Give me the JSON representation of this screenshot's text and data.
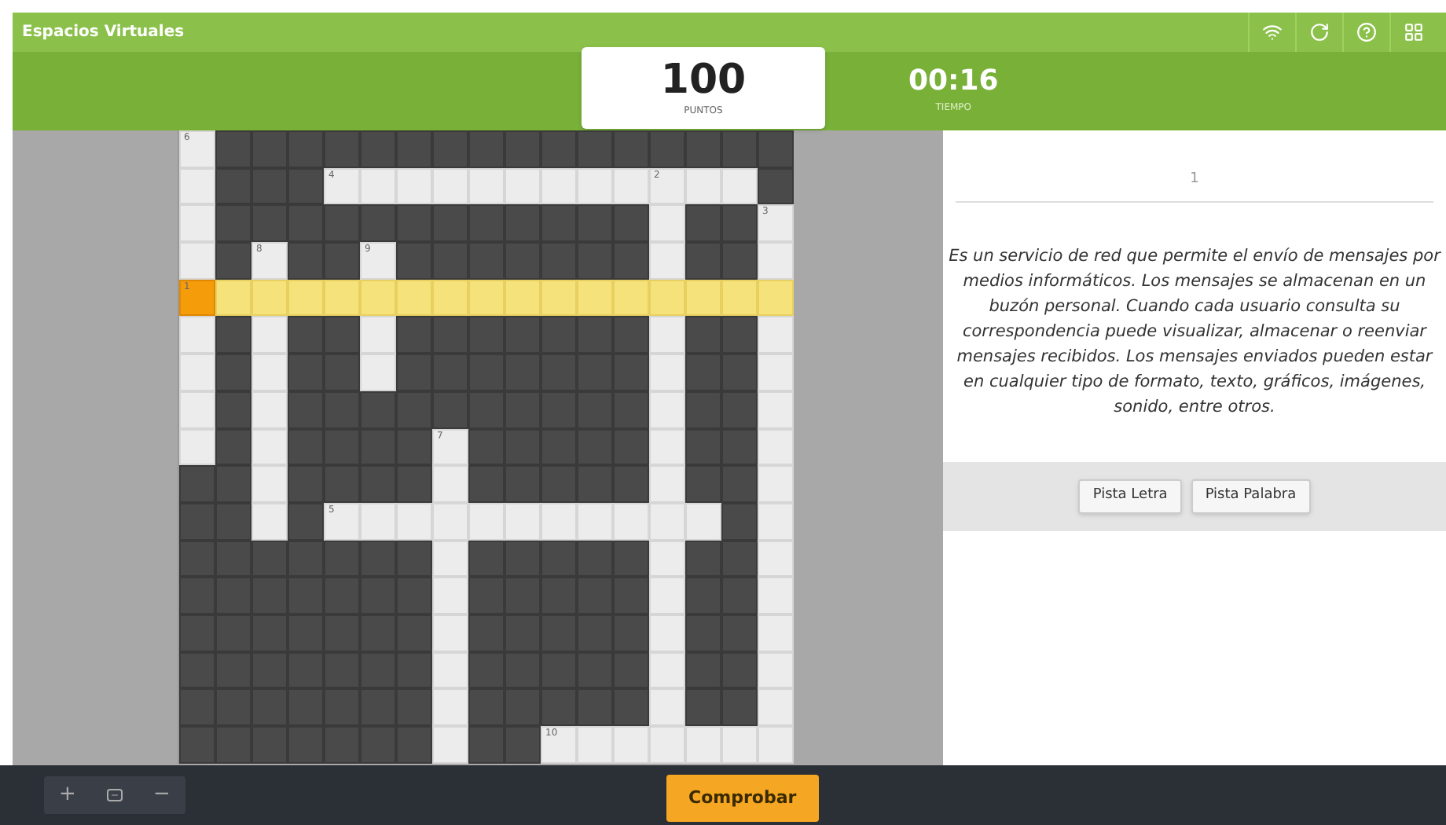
{
  "app": {
    "title": "Espacios Virtuales"
  },
  "score": {
    "value": "100",
    "label": "PUNTOS"
  },
  "timer": {
    "value": "00:16",
    "label": "TIEMPO"
  },
  "grid": {
    "rows": [
      [
        {
          "kind": "open",
          "number": "6"
        },
        {
          "kind": "block"
        },
        {
          "kind": "block"
        },
        {
          "kind": "block"
        },
        {
          "kind": "block"
        },
        {
          "kind": "block"
        },
        {
          "kind": "block"
        },
        {
          "kind": "block"
        },
        {
          "kind": "block"
        },
        {
          "kind": "block"
        },
        {
          "kind": "block"
        },
        {
          "kind": "block"
        },
        {
          "kind": "block"
        },
        {
          "kind": "block"
        },
        {
          "kind": "block"
        },
        {
          "kind": "block"
        },
        {
          "kind": "block"
        }
      ],
      [
        {
          "kind": "open"
        },
        {
          "kind": "block"
        },
        {
          "kind": "block"
        },
        {
          "kind": "block"
        },
        {
          "kind": "open",
          "number": "4"
        },
        {
          "kind": "open"
        },
        {
          "kind": "open"
        },
        {
          "kind": "open"
        },
        {
          "kind": "open"
        },
        {
          "kind": "open"
        },
        {
          "kind": "open"
        },
        {
          "kind": "open"
        },
        {
          "kind": "open"
        },
        {
          "kind": "open",
          "number": "2"
        },
        {
          "kind": "open"
        },
        {
          "kind": "open"
        },
        {
          "kind": "block"
        }
      ],
      [
        {
          "kind": "open"
        },
        {
          "kind": "block"
        },
        {
          "kind": "block"
        },
        {
          "kind": "block"
        },
        {
          "kind": "block"
        },
        {
          "kind": "block"
        },
        {
          "kind": "block"
        },
        {
          "kind": "block"
        },
        {
          "kind": "block"
        },
        {
          "kind": "block"
        },
        {
          "kind": "block"
        },
        {
          "kind": "block"
        },
        {
          "kind": "block"
        },
        {
          "kind": "open"
        },
        {
          "kind": "block"
        },
        {
          "kind": "block"
        },
        {
          "kind": "open",
          "number": "3"
        }
      ],
      [
        {
          "kind": "open"
        },
        {
          "kind": "block"
        },
        {
          "kind": "open",
          "number": "8"
        },
        {
          "kind": "block"
        },
        {
          "kind": "block"
        },
        {
          "kind": "open",
          "number": "9"
        },
        {
          "kind": "block"
        },
        {
          "kind": "block"
        },
        {
          "kind": "block"
        },
        {
          "kind": "block"
        },
        {
          "kind": "block"
        },
        {
          "kind": "block"
        },
        {
          "kind": "block"
        },
        {
          "kind": "open"
        },
        {
          "kind": "block"
        },
        {
          "kind": "block"
        },
        {
          "kind": "open"
        }
      ],
      [
        {
          "kind": "selected",
          "number": "1"
        },
        {
          "kind": "highlighted"
        },
        {
          "kind": "highlighted"
        },
        {
          "kind": "highlighted"
        },
        {
          "kind": "highlighted"
        },
        {
          "kind": "highlighted"
        },
        {
          "kind": "highlighted"
        },
        {
          "kind": "highlighted"
        },
        {
          "kind": "highlighted"
        },
        {
          "kind": "highlighted"
        },
        {
          "kind": "highlighted"
        },
        {
          "kind": "highlighted"
        },
        {
          "kind": "highlighted"
        },
        {
          "kind": "highlighted"
        },
        {
          "kind": "highlighted"
        },
        {
          "kind": "highlighted"
        },
        {
          "kind": "highlighted"
        }
      ],
      [
        {
          "kind": "open"
        },
        {
          "kind": "block"
        },
        {
          "kind": "open"
        },
        {
          "kind": "block"
        },
        {
          "kind": "block"
        },
        {
          "kind": "open"
        },
        {
          "kind": "block"
        },
        {
          "kind": "block"
        },
        {
          "kind": "block"
        },
        {
          "kind": "block"
        },
        {
          "kind": "block"
        },
        {
          "kind": "block"
        },
        {
          "kind": "block"
        },
        {
          "kind": "open"
        },
        {
          "kind": "block"
        },
        {
          "kind": "block"
        },
        {
          "kind": "open"
        }
      ],
      [
        {
          "kind": "open"
        },
        {
          "kind": "block"
        },
        {
          "kind": "open"
        },
        {
          "kind": "block"
        },
        {
          "kind": "block"
        },
        {
          "kind": "open"
        },
        {
          "kind": "block"
        },
        {
          "kind": "block"
        },
        {
          "kind": "block"
        },
        {
          "kind": "block"
        },
        {
          "kind": "block"
        },
        {
          "kind": "block"
        },
        {
          "kind": "block"
        },
        {
          "kind": "open"
        },
        {
          "kind": "block"
        },
        {
          "kind": "block"
        },
        {
          "kind": "open"
        }
      ],
      [
        {
          "kind": "open"
        },
        {
          "kind": "block"
        },
        {
          "kind": "open"
        },
        {
          "kind": "block"
        },
        {
          "kind": "block"
        },
        {
          "kind": "block"
        },
        {
          "kind": "block"
        },
        {
          "kind": "block"
        },
        {
          "kind": "block"
        },
        {
          "kind": "block"
        },
        {
          "kind": "block"
        },
        {
          "kind": "block"
        },
        {
          "kind": "block"
        },
        {
          "kind": "open"
        },
        {
          "kind": "block"
        },
        {
          "kind": "block"
        },
        {
          "kind": "open"
        }
      ],
      [
        {
          "kind": "open"
        },
        {
          "kind": "block"
        },
        {
          "kind": "open"
        },
        {
          "kind": "block"
        },
        {
          "kind": "block"
        },
        {
          "kind": "block"
        },
        {
          "kind": "block"
        },
        {
          "kind": "open",
          "number": "7"
        },
        {
          "kind": "block"
        },
        {
          "kind": "block"
        },
        {
          "kind": "block"
        },
        {
          "kind": "block"
        },
        {
          "kind": "block"
        },
        {
          "kind": "open"
        },
        {
          "kind": "block"
        },
        {
          "kind": "block"
        },
        {
          "kind": "open"
        }
      ],
      [
        {
          "kind": "block"
        },
        {
          "kind": "block"
        },
        {
          "kind": "open"
        },
        {
          "kind": "block"
        },
        {
          "kind": "block"
        },
        {
          "kind": "block"
        },
        {
          "kind": "block"
        },
        {
          "kind": "open"
        },
        {
          "kind": "block"
        },
        {
          "kind": "block"
        },
        {
          "kind": "block"
        },
        {
          "kind": "block"
        },
        {
          "kind": "block"
        },
        {
          "kind": "open"
        },
        {
          "kind": "block"
        },
        {
          "kind": "block"
        },
        {
          "kind": "open"
        }
      ],
      [
        {
          "kind": "block"
        },
        {
          "kind": "block"
        },
        {
          "kind": "open"
        },
        {
          "kind": "block"
        },
        {
          "kind": "open",
          "number": "5"
        },
        {
          "kind": "open"
        },
        {
          "kind": "open"
        },
        {
          "kind": "open"
        },
        {
          "kind": "open"
        },
        {
          "kind": "open"
        },
        {
          "kind": "open"
        },
        {
          "kind": "open"
        },
        {
          "kind": "open"
        },
        {
          "kind": "open"
        },
        {
          "kind": "open"
        },
        {
          "kind": "block"
        },
        {
          "kind": "open"
        }
      ],
      [
        {
          "kind": "block"
        },
        {
          "kind": "block"
        },
        {
          "kind": "block"
        },
        {
          "kind": "block"
        },
        {
          "kind": "block"
        },
        {
          "kind": "block"
        },
        {
          "kind": "block"
        },
        {
          "kind": "open"
        },
        {
          "kind": "block"
        },
        {
          "kind": "block"
        },
        {
          "kind": "block"
        },
        {
          "kind": "block"
        },
        {
          "kind": "block"
        },
        {
          "kind": "open"
        },
        {
          "kind": "block"
        },
        {
          "kind": "block"
        },
        {
          "kind": "open"
        }
      ],
      [
        {
          "kind": "block"
        },
        {
          "kind": "block"
        },
        {
          "kind": "block"
        },
        {
          "kind": "block"
        },
        {
          "kind": "block"
        },
        {
          "kind": "block"
        },
        {
          "kind": "block"
        },
        {
          "kind": "open"
        },
        {
          "kind": "block"
        },
        {
          "kind": "block"
        },
        {
          "kind": "block"
        },
        {
          "kind": "block"
        },
        {
          "kind": "block"
        },
        {
          "kind": "open"
        },
        {
          "kind": "block"
        },
        {
          "kind": "block"
        },
        {
          "kind": "open"
        }
      ],
      [
        {
          "kind": "block"
        },
        {
          "kind": "block"
        },
        {
          "kind": "block"
        },
        {
          "kind": "block"
        },
        {
          "kind": "block"
        },
        {
          "kind": "block"
        },
        {
          "kind": "block"
        },
        {
          "kind": "open"
        },
        {
          "kind": "block"
        },
        {
          "kind": "block"
        },
        {
          "kind": "block"
        },
        {
          "kind": "block"
        },
        {
          "kind": "block"
        },
        {
          "kind": "open"
        },
        {
          "kind": "block"
        },
        {
          "kind": "block"
        },
        {
          "kind": "open"
        }
      ],
      [
        {
          "kind": "block"
        },
        {
          "kind": "block"
        },
        {
          "kind": "block"
        },
        {
          "kind": "block"
        },
        {
          "kind": "block"
        },
        {
          "kind": "block"
        },
        {
          "kind": "block"
        },
        {
          "kind": "open"
        },
        {
          "kind": "block"
        },
        {
          "kind": "block"
        },
        {
          "kind": "block"
        },
        {
          "kind": "block"
        },
        {
          "kind": "block"
        },
        {
          "kind": "open"
        },
        {
          "kind": "block"
        },
        {
          "kind": "block"
        },
        {
          "kind": "open"
        }
      ],
      [
        {
          "kind": "block"
        },
        {
          "kind": "block"
        },
        {
          "kind": "block"
        },
        {
          "kind": "block"
        },
        {
          "kind": "block"
        },
        {
          "kind": "block"
        },
        {
          "kind": "block"
        },
        {
          "kind": "open"
        },
        {
          "kind": "block"
        },
        {
          "kind": "block"
        },
        {
          "kind": "block"
        },
        {
          "kind": "block"
        },
        {
          "kind": "block"
        },
        {
          "kind": "open"
        },
        {
          "kind": "block"
        },
        {
          "kind": "block"
        },
        {
          "kind": "open"
        }
      ],
      [
        {
          "kind": "block"
        },
        {
          "kind": "block"
        },
        {
          "kind": "block"
        },
        {
          "kind": "block"
        },
        {
          "kind": "block"
        },
        {
          "kind": "block"
        },
        {
          "kind": "block"
        },
        {
          "kind": "open"
        },
        {
          "kind": "block"
        },
        {
          "kind": "block"
        },
        {
          "kind": "open",
          "number": "10"
        },
        {
          "kind": "open"
        },
        {
          "kind": "open"
        },
        {
          "kind": "open"
        },
        {
          "kind": "open"
        },
        {
          "kind": "open"
        },
        {
          "kind": "open"
        }
      ]
    ]
  },
  "clue": {
    "number": "1",
    "text": "Es un servicio de red que permite el envío de mensajes por medios informáticos. Los mensajes se almacenan en un buzón personal. Cuando cada usuario consulta su correspondencia puede visualizar, almacenar o reenviar mensajes recibidos. Los mensajes enviados pueden estar en cualquier tipo de formato, texto, gráficos, imágenes, sonido, entre otros."
  },
  "hint_buttons": [
    "Pista Letra",
    "Pista Palabra"
  ],
  "zoom_buttons": [
    "+",
    "−"
  ],
  "check_button": "Comprobar"
}
